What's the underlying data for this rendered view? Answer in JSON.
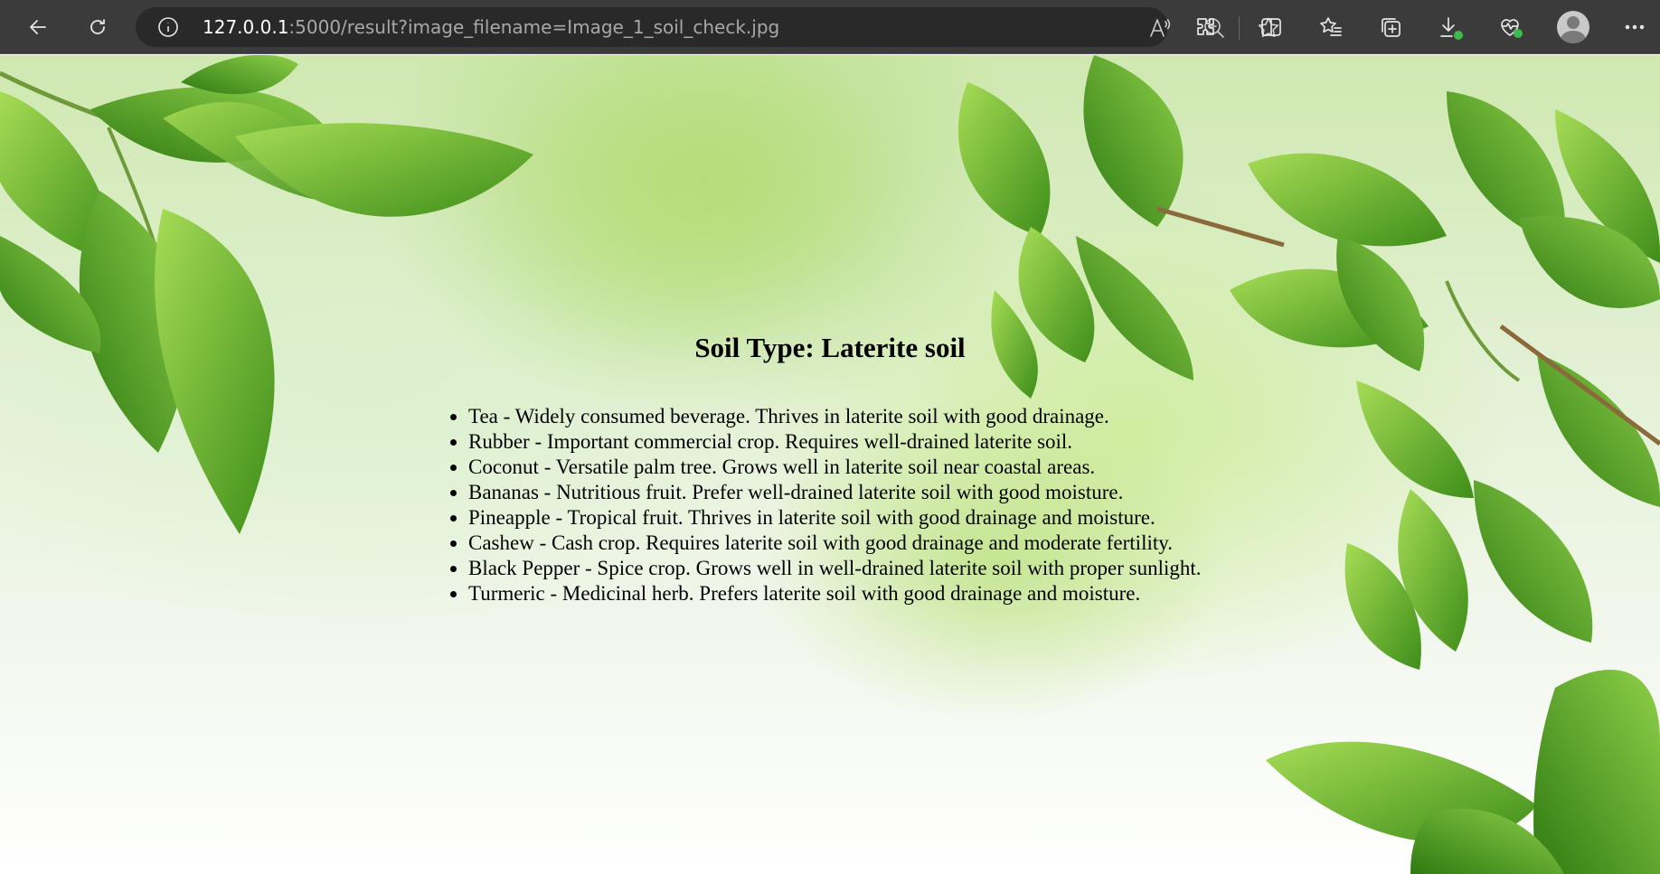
{
  "browser": {
    "url_host": "127.0.0.1",
    "url_rest": ":5000/result?image_filename=Image_1_soil_check.jpg",
    "read_aloud_glyph": "A)",
    "icons": [
      "back-icon",
      "reload-icon",
      "site-info-icon",
      "read-aloud-icon",
      "zoom-out-icon",
      "favorite-star-icon",
      "extensions-icon",
      "split-screen-icon",
      "favorites-icon",
      "collections-icon",
      "downloads-icon",
      "browser-essentials-icon",
      "profile-avatar",
      "more-menu-icon"
    ]
  },
  "page": {
    "title": "Soil Type: Laterite soil",
    "crops": [
      "Tea - Widely consumed beverage. Thrives in laterite soil with good drainage.",
      "Rubber - Important commercial crop. Requires well-drained laterite soil.",
      "Coconut - Versatile palm tree. Grows well in laterite soil near coastal areas.",
      "Bananas - Nutritious fruit. Prefer well-drained laterite soil with good moisture.",
      "Pineapple - Tropical fruit. Thrives in laterite soil with good drainage and moisture.",
      "Cashew - Cash crop. Requires laterite soil with good drainage and moderate fertility.",
      "Black Pepper - Spice crop. Grows well in well-drained laterite soil with proper sunlight.",
      "Turmeric - Medicinal herb. Prefers laterite soil with good drainage and moisture."
    ]
  },
  "colors": {
    "toolbar_bg": "#3b3b3b",
    "address_bg": "#292929",
    "leaf_green": "#5fa82a",
    "leaf_light": "#9fd45a",
    "status_green": "#3fb950"
  }
}
